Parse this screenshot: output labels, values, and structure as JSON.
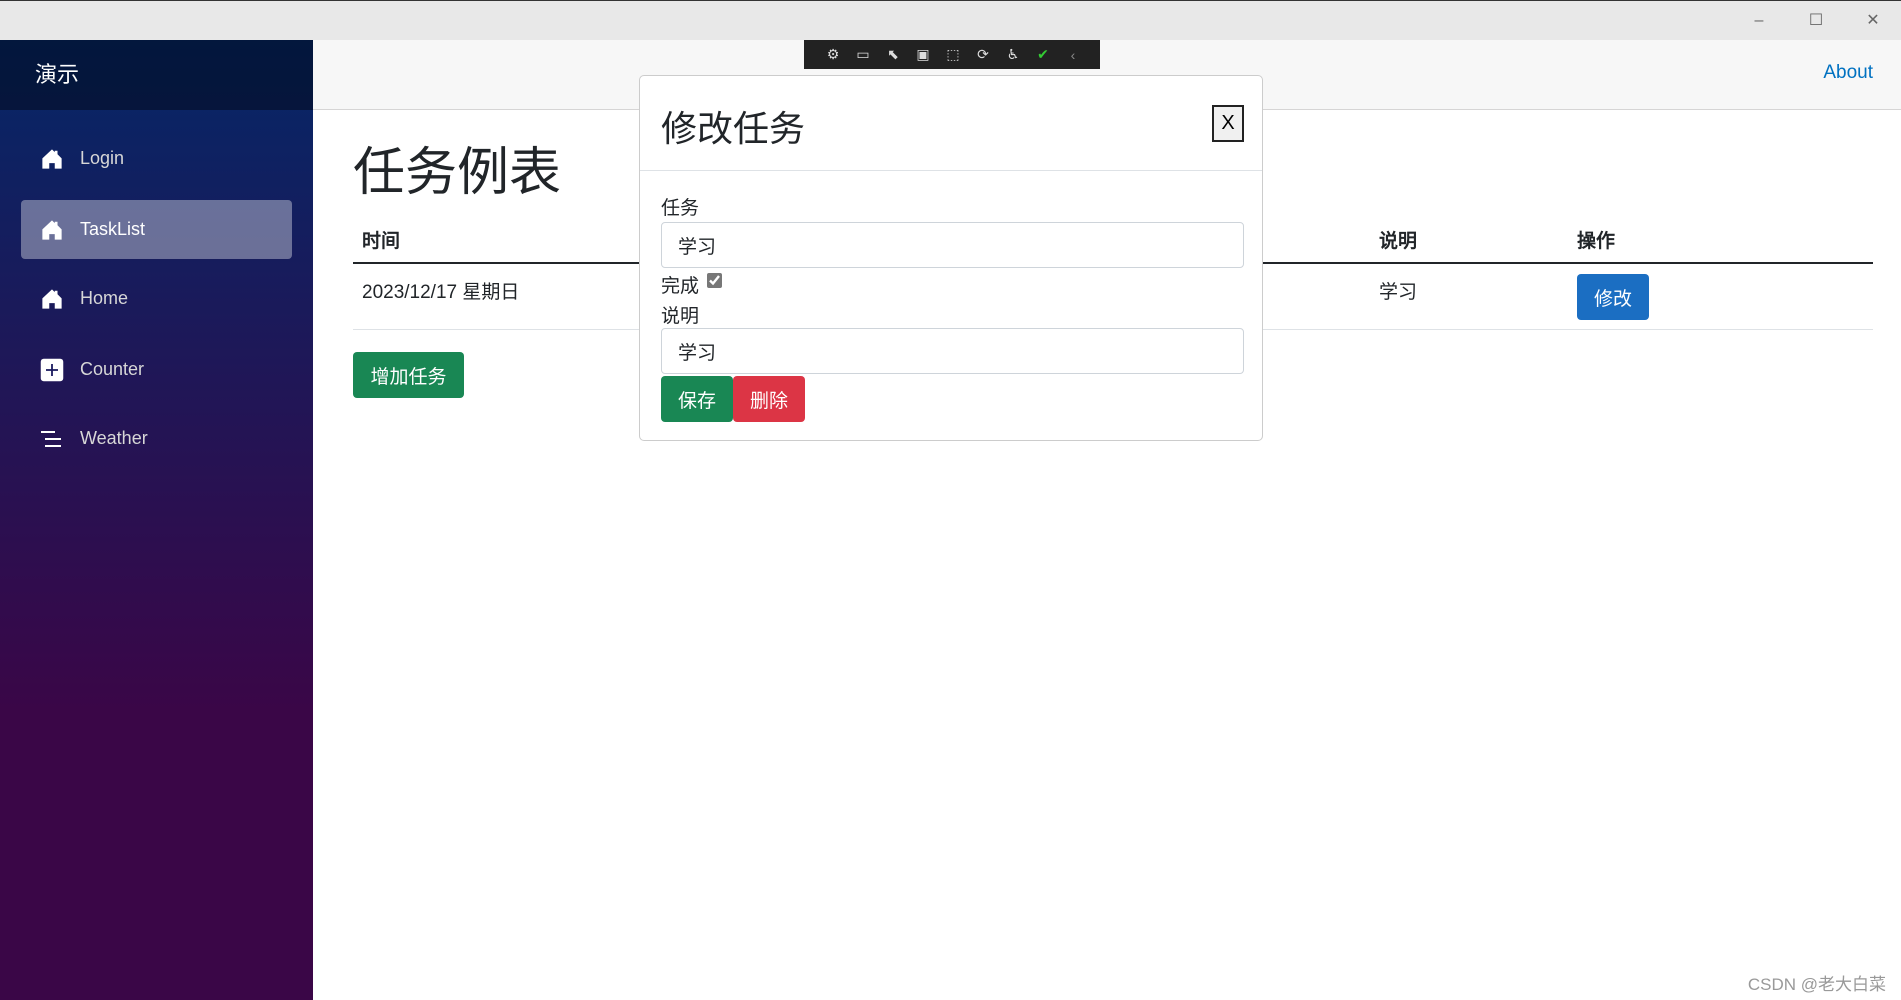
{
  "window": {
    "minimize": "–",
    "maximize": "☐",
    "close": "✕"
  },
  "sidebar": {
    "brand": "演示",
    "items": [
      {
        "label": "Login",
        "icon": "home-icon",
        "active": false
      },
      {
        "label": "TaskList",
        "icon": "home-icon",
        "active": true
      },
      {
        "label": "Home",
        "icon": "home-icon",
        "active": false
      },
      {
        "label": "Counter",
        "icon": "plus-square-icon",
        "active": false
      },
      {
        "label": "Weather",
        "icon": "list-icon",
        "active": false
      }
    ]
  },
  "topbar": {
    "about": "About"
  },
  "devtools": {
    "icons": [
      "select-element-icon",
      "video-icon",
      "pointer-icon",
      "layout-icon",
      "track-focus-icon",
      "hot-reload-icon",
      "accessibility-icon",
      "check-icon",
      "collapse-icon"
    ]
  },
  "main": {
    "title": "任务例表",
    "columns": {
      "time": "时间",
      "desc": "说明",
      "action": "操作"
    },
    "rows": [
      {
        "time": "2023/12/17 星期日",
        "desc": "学习",
        "action": "修改"
      }
    ],
    "add_button": "增加任务"
  },
  "modal": {
    "title": "修改任务",
    "close": "X",
    "task_label": "任务",
    "task_value": "学习",
    "done_label": "完成",
    "done_checked": true,
    "desc_label": "说明",
    "desc_value": "学习",
    "save": "保存",
    "delete": "删除"
  },
  "colors": {
    "primary": "#1b6ec2",
    "success": "#198754",
    "danger": "#dc3545",
    "link": "#0071c1"
  },
  "watermark": "CSDN @老大白菜"
}
